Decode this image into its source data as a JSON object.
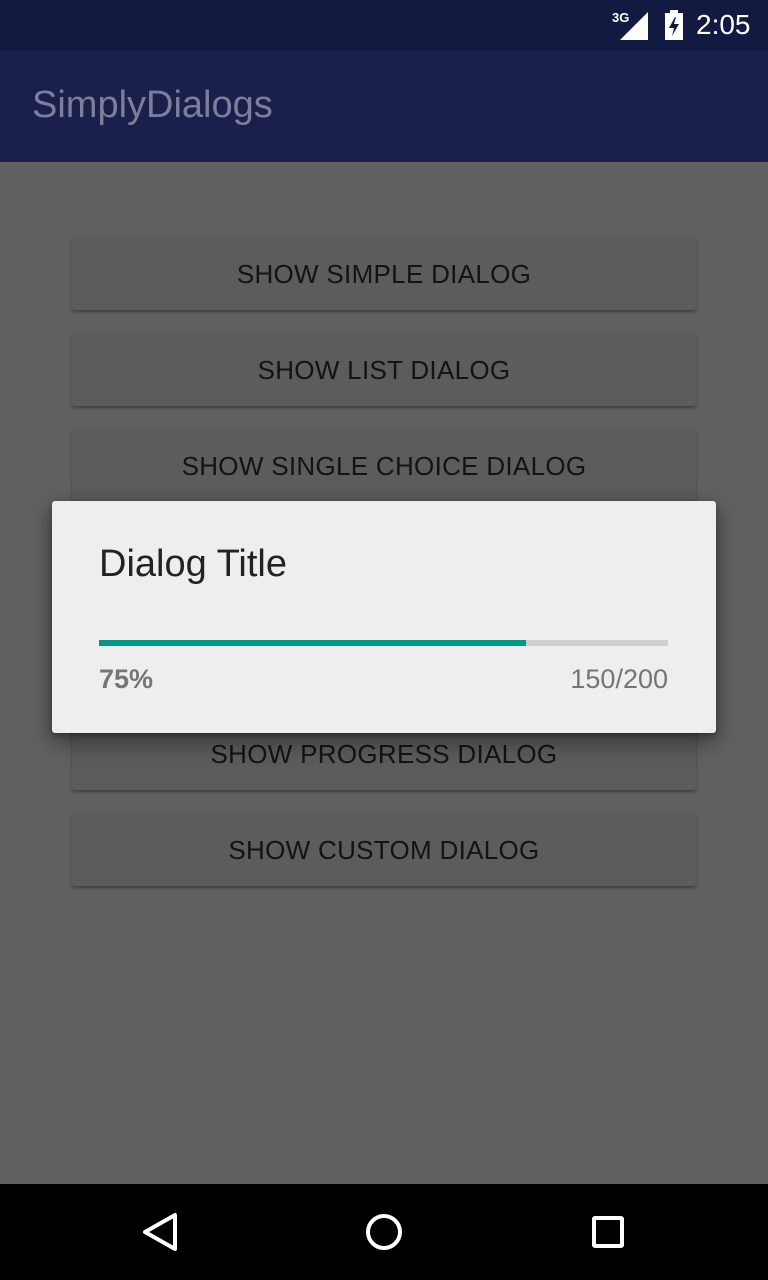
{
  "status_bar": {
    "network": "3G",
    "time": "2:05",
    "icons": [
      "signal-icon",
      "battery-charging-icon"
    ]
  },
  "app_bar": {
    "title": "SimplyDialogs"
  },
  "buttons": [
    {
      "label": "SHOW SIMPLE DIALOG"
    },
    {
      "label": "SHOW LIST DIALOG"
    },
    {
      "label": "SHOW SINGLE CHOICE DIALOG"
    },
    {
      "label": "SHOW PROGRESS DIALOG"
    },
    {
      "label": "SHOW CUSTOM DIALOG"
    }
  ],
  "dialog": {
    "title": "Dialog Title",
    "progress_fraction": 0.75,
    "percent_text": "75%",
    "count_text": "150/200",
    "accent_color": "#009688"
  },
  "nav_bar": {
    "icons": [
      "back-icon",
      "home-icon",
      "recents-icon"
    ]
  },
  "colors": {
    "status_bar": "#131a42",
    "app_bar": "#1a1f4b",
    "scrim_background": "#616161",
    "dialog_background": "#eeeeee"
  }
}
